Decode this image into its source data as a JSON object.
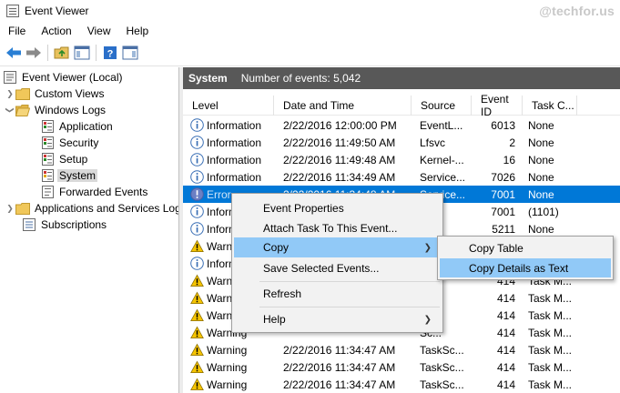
{
  "window": {
    "title": "Event Viewer",
    "watermark": "@techfor.us"
  },
  "menu": [
    "File",
    "Action",
    "View",
    "Help"
  ],
  "toolbar": {
    "icons": [
      "back-arrow-icon",
      "forward-arrow-icon",
      "folder-up-icon",
      "show-hide-tree-icon",
      "help-icon",
      "action-pane-icon"
    ]
  },
  "tree": {
    "root": "Event Viewer (Local)",
    "custom_views": "Custom Views",
    "windows_logs": "Windows Logs",
    "application": "Application",
    "security": "Security",
    "setup": "Setup",
    "system": "System",
    "forwarded": "Forwarded Events",
    "apps_services": "Applications and Services Logs",
    "subscriptions": "Subscriptions"
  },
  "main": {
    "header_name": "System",
    "header_count": "Number of events: 5,042",
    "columns": {
      "level": "Level",
      "date": "Date and Time",
      "source": "Source",
      "event_id": "Event ID",
      "task": "Task C..."
    }
  },
  "rows": [
    {
      "level": "Information",
      "type": "info",
      "date": "2/22/2016 12:00:00 PM",
      "source": "EventL...",
      "id": "6013",
      "task": "None"
    },
    {
      "level": "Information",
      "type": "info",
      "date": "2/22/2016 11:49:50 AM",
      "source": "Lfsvc",
      "id": "2",
      "task": "None"
    },
    {
      "level": "Information",
      "type": "info",
      "date": "2/22/2016 11:49:48 AM",
      "source": "Kernel-...",
      "id": "16",
      "task": "None"
    },
    {
      "level": "Information",
      "type": "info",
      "date": "2/22/2016 11:34:49 AM",
      "source": "Service...",
      "id": "7026",
      "task": "None"
    },
    {
      "level": "Error",
      "type": "error",
      "date": "2/22/2016 11:34:48 AM",
      "source": "Service...",
      "id": "7001",
      "task": "None"
    },
    {
      "level": "Information",
      "type": "info",
      "date": "",
      "source": "og...",
      "id": "7001",
      "task": "(1101)"
    },
    {
      "level": "Information",
      "type": "info",
      "date": "",
      "source": "",
      "id": "5211",
      "task": "None"
    },
    {
      "level": "Warning",
      "type": "warn",
      "date": "",
      "source": "",
      "id": "",
      "task": ""
    },
    {
      "level": "Information",
      "type": "info",
      "date": "",
      "source": "",
      "id": "",
      "task": ""
    },
    {
      "level": "Warning",
      "type": "warn",
      "date": "",
      "source": "Sc...",
      "id": "414",
      "task": "Task M..."
    },
    {
      "level": "Warning",
      "type": "warn",
      "date": "",
      "source": "Sc...",
      "id": "414",
      "task": "Task M..."
    },
    {
      "level": "Warning",
      "type": "warn",
      "date": "",
      "source": "Sc...",
      "id": "414",
      "task": "Task M..."
    },
    {
      "level": "Warning",
      "type": "warn",
      "date": "",
      "source": "Sc...",
      "id": "414",
      "task": "Task M..."
    },
    {
      "level": "Warning",
      "type": "warn",
      "date": "2/22/2016 11:34:47 AM",
      "source": "TaskSc...",
      "id": "414",
      "task": "Task M..."
    },
    {
      "level": "Warning",
      "type": "warn",
      "date": "2/22/2016 11:34:47 AM",
      "source": "TaskSc...",
      "id": "414",
      "task": "Task M..."
    },
    {
      "level": "Warning",
      "type": "warn",
      "date": "2/22/2016 11:34:47 AM",
      "source": "TaskSc...",
      "id": "414",
      "task": "Task M..."
    }
  ],
  "context_menu": {
    "event_properties": "Event Properties",
    "attach_task": "Attach Task To This Event...",
    "copy": "Copy",
    "save_selected": "Save Selected Events...",
    "refresh": "Refresh",
    "help": "Help"
  },
  "submenu": {
    "copy_table": "Copy Table",
    "copy_details": "Copy Details as Text"
  },
  "colors": {
    "selection": "#0078d7",
    "menu_hover": "#91c9f7",
    "header_bg": "#585858"
  }
}
